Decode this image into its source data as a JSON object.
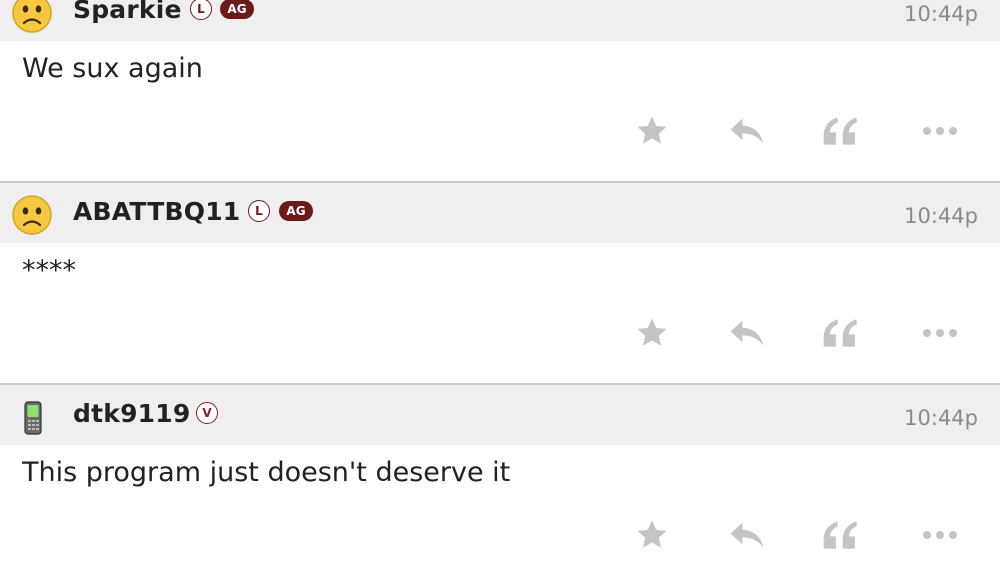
{
  "posts": [
    {
      "username": "Sparkie",
      "badge_l": "L",
      "badge_ag": "AG",
      "time": "10:44p",
      "message": "We sux again",
      "avatar_icon": "sad-face-emoji"
    },
    {
      "username": "ABATTBQ11",
      "badge_l": "L",
      "badge_ag": "AG",
      "time": "10:44p",
      "message": "****",
      "avatar_icon": "sad-face-emoji"
    },
    {
      "username": "dtk9119",
      "badge_v": "V",
      "time": "10:44p",
      "message": "This program just doesn't deserve it",
      "avatar_icon": "mobile-phone-icon"
    }
  ],
  "actions": [
    "star-icon",
    "reply-icon",
    "quote-icon",
    "more-icon"
  ],
  "colors": {
    "header_bg": "#efefef",
    "badge": "#6b1a1a",
    "action_icon": "#c4c4c4",
    "time": "#8a8a8a"
  }
}
